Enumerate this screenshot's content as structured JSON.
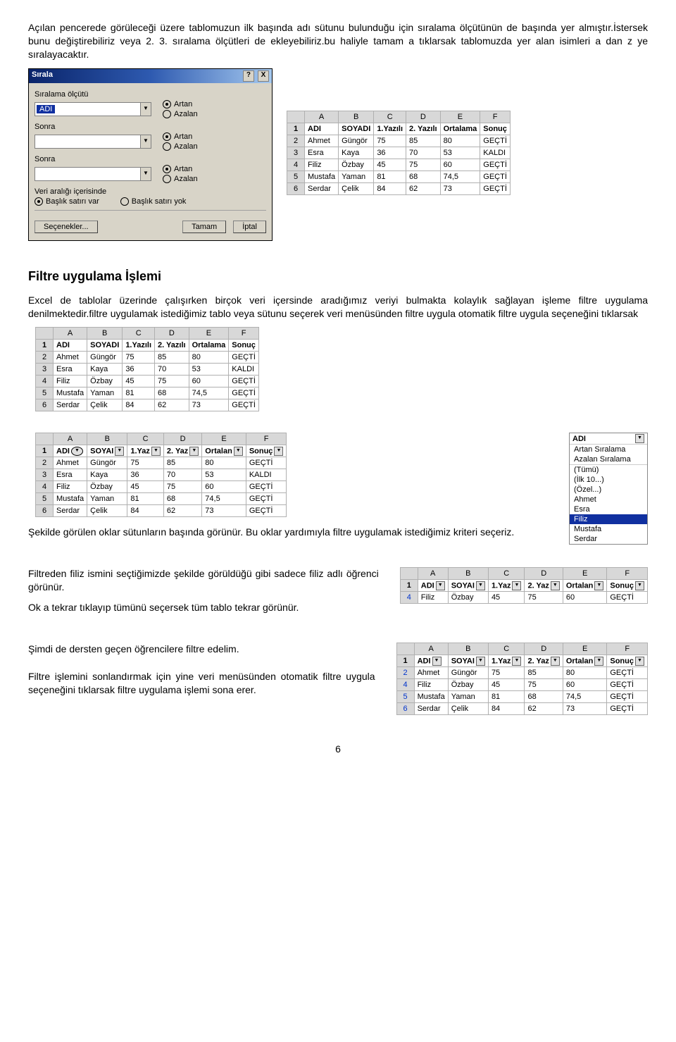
{
  "para1": "Açılan pencerede görüleceği üzere tablomuzun ilk başında adı sütunu bulunduğu için sıralama ölçütünün de başında yer almıştır.İstersek bunu değiştirebiliriz veya 2. 3. sıralama ölçütleri de ekleyebiliriz.bu haliyle tamam a tıklarsak tablomuzda yer alan isimleri a dan z ye sıralayacaktır.",
  "dialog": {
    "title": "Sırala",
    "help": "?",
    "close": "X",
    "primary_label": "Sıralama ölçütü",
    "primary_value": "ADI",
    "sonra": "Sonra",
    "artan": "Artan",
    "azalan": "Azalan",
    "veri_header": "Veri aralığı içerisinde",
    "baslik_var": "Başlık satırı var",
    "baslik_yok": "Başlık satırı yok",
    "secenekler": "Seçenekler...",
    "tamam": "Tamam",
    "iptal": "İptal"
  },
  "cols": [
    "A",
    "B",
    "C",
    "D",
    "E",
    "F"
  ],
  "headers": [
    "ADI",
    "SOYADI",
    "1.Yazılı",
    "2. Yazılı",
    "Ortalama",
    "Sonuç"
  ],
  "headers_short": [
    "ADI",
    "SOYAI",
    "1.Yaz",
    "2. Yaz",
    "Ortalan",
    "Sonuç"
  ],
  "rows_sorted": [
    [
      "Ahmet",
      "Güngör",
      "75",
      "85",
      "80",
      "GEÇTİ"
    ],
    [
      "Esra",
      "Kaya",
      "36",
      "70",
      "53",
      "KALDI"
    ],
    [
      "Filiz",
      "Özbay",
      "45",
      "75",
      "60",
      "GEÇTİ"
    ],
    [
      "Mustafa",
      "Yaman",
      "81",
      "68",
      "74,5",
      "GEÇTİ"
    ],
    [
      "Serdar",
      "Çelik",
      "84",
      "62",
      "73",
      "GEÇTİ"
    ]
  ],
  "h2": "Filtre uygulama İşlemi",
  "para2": "Excel de tablolar üzerinde çalışırken birçok veri içersinde aradığımız veriyi bulmakta kolaylık sağlayan işleme filtre uygulama denilmektedir.filtre uygulamak istediğimiz tablo veya sütunu seçerek veri menüsünden filtre uygula otomatik filtre uygula seçeneğini tıklarsak",
  "para3": "Şekilde görülen oklar sütunların başında görünür. Bu oklar yardımıyla filtre uygulamak istediğimiz kriteri seçeriz.",
  "dropdown": {
    "header": "ADI",
    "items_top": [
      "Artan Sıralama",
      "Azalan Sıralama"
    ],
    "items_mid": [
      "(Tümü)",
      "(İlk 10...)",
      "(Özel...)",
      "Ahmet",
      "Esra"
    ],
    "highlight": "Filiz",
    "items_bot": [
      "Mustafa",
      "Serdar"
    ]
  },
  "para4": "Filtreden filiz ismini seçtiğimizde şekilde görüldüğü gibi sadece filiz adlı öğrenci görünür.",
  "para5": "Ok a tekrar tıklayıp tümünü seçersek tüm tablo tekrar görünür.",
  "row_filiz": [
    "Filiz",
    "Özbay",
    "45",
    "75",
    "60",
    "GEÇTİ"
  ],
  "para6": "Şimdi de dersten geçen öğrencilere filtre edelim.",
  "para7": "Filtre işlemini sonlandırmak için yine veri menüsünden otomatik filtre uygula seçeneğini tıklarsak  filtre uygulama işlemi sona erer.",
  "rows_gecti": [
    [
      "2",
      "Ahmet",
      "Güngör",
      "75",
      "85",
      "80",
      "GEÇTİ"
    ],
    [
      "4",
      "Filiz",
      "Özbay",
      "45",
      "75",
      "60",
      "GEÇTİ"
    ],
    [
      "5",
      "Mustafa",
      "Yaman",
      "81",
      "68",
      "74,5",
      "GEÇTİ"
    ],
    [
      "6",
      "Serdar",
      "Çelik",
      "84",
      "62",
      "73",
      "GEÇTİ"
    ]
  ],
  "pagenum": "6",
  "chart_data": [
    {
      "type": "table",
      "title": "Sorted data (after Sırala dialog)",
      "columns": [
        "ADI",
        "SOYADI",
        "1.Yazılı",
        "2. Yazılı",
        "Ortalama",
        "Sonuç"
      ],
      "rows": [
        [
          "Ahmet",
          "Güngör",
          75,
          85,
          80,
          "GEÇTİ"
        ],
        [
          "Esra",
          "Kaya",
          36,
          70,
          53,
          "KALDI"
        ],
        [
          "Filiz",
          "Özbay",
          45,
          75,
          60,
          "GEÇTİ"
        ],
        [
          "Mustafa",
          "Yaman",
          81,
          68,
          74.5,
          "GEÇTİ"
        ],
        [
          "Serdar",
          "Çelik",
          84,
          62,
          73,
          "GEÇTİ"
        ]
      ]
    },
    {
      "type": "table",
      "title": "Filtered by ADI=Filiz",
      "columns": [
        "ADI",
        "SOYADI",
        "1.Yazılı",
        "2. Yazılı",
        "Ortalama",
        "Sonuç"
      ],
      "rows": [
        [
          "Filiz",
          "Özbay",
          45,
          75,
          60,
          "GEÇTİ"
        ]
      ]
    },
    {
      "type": "table",
      "title": "Filtered by Sonuç=GEÇTİ",
      "columns": [
        "ADI",
        "SOYADI",
        "1.Yazılı",
        "2. Yazılı",
        "Ortalama",
        "Sonuç"
      ],
      "rows": [
        [
          "Ahmet",
          "Güngör",
          75,
          85,
          80,
          "GEÇTİ"
        ],
        [
          "Filiz",
          "Özbay",
          45,
          75,
          60,
          "GEÇTİ"
        ],
        [
          "Mustafa",
          "Yaman",
          81,
          68,
          74.5,
          "GEÇTİ"
        ],
        [
          "Serdar",
          "Çelik",
          84,
          62,
          73,
          "GEÇTİ"
        ]
      ]
    }
  ]
}
